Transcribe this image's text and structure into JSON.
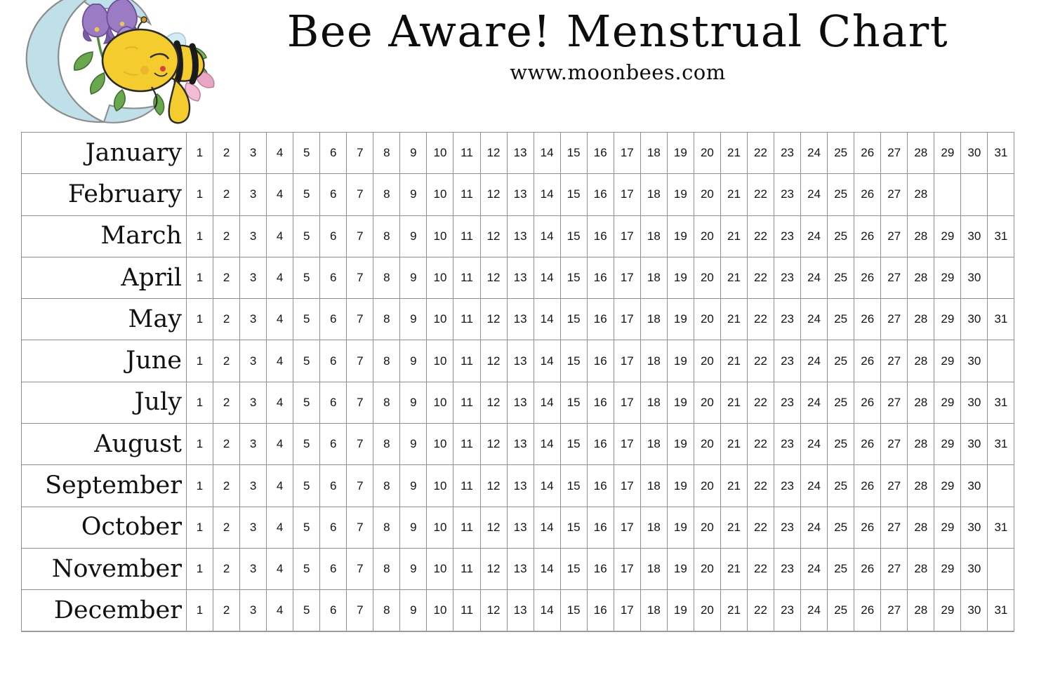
{
  "page": {
    "background_color": "#ffffff"
  },
  "header": {
    "title": "Bee Aware! Menstrual Chart",
    "subtitle": "www.moonbees.com",
    "logo": {
      "name": "moon-bee-logo",
      "description": "sleeping bee on crescent moon with bellflowers",
      "colors": {
        "moon": "#bfe0e8",
        "moon_outline": "#8c8c8c",
        "bee_body": "#f4cc2e",
        "bee_stripe": "#1a1a1a",
        "flower_purple": "#9b7bc4",
        "flower_purple_dark": "#7a5aa8",
        "flower_pink": "#e8a6c4",
        "leaf_green": "#6aa84f",
        "stem_green": "#4e8a3a",
        "wing": "#cfe9f2"
      }
    }
  },
  "table": {
    "columns": {
      "month_header": "",
      "days": [
        1,
        2,
        3,
        4,
        5,
        6,
        7,
        8,
        9,
        10,
        11,
        12,
        13,
        14,
        15,
        16,
        17,
        18,
        19,
        20,
        21,
        22,
        23,
        24,
        25,
        26,
        27,
        28,
        29,
        30,
        31
      ]
    },
    "total_day_columns": 31,
    "grid_color": "#8f8f8f",
    "rows": [
      {
        "month": "January",
        "days_in_month": 31
      },
      {
        "month": "February",
        "days_in_month": 28
      },
      {
        "month": "March",
        "days_in_month": 31
      },
      {
        "month": "April",
        "days_in_month": 30
      },
      {
        "month": "May",
        "days_in_month": 31
      },
      {
        "month": "June",
        "days_in_month": 30
      },
      {
        "month": "July",
        "days_in_month": 31
      },
      {
        "month": "August",
        "days_in_month": 31
      },
      {
        "month": "September",
        "days_in_month": 30
      },
      {
        "month": "October",
        "days_in_month": 31
      },
      {
        "month": "November",
        "days_in_month": 30
      },
      {
        "month": "December",
        "days_in_month": 31
      }
    ]
  },
  "chart_data": {
    "type": "table",
    "title": "Bee Aware! Menstrual Chart",
    "subtitle": "www.moonbees.com",
    "description": "Blank 12-month menstrual tracking grid; one row per month, one cell per day of month, all cells empty for marking.",
    "row_labels": [
      "January",
      "February",
      "March",
      "April",
      "May",
      "June",
      "July",
      "August",
      "September",
      "October",
      "November",
      "December"
    ],
    "column_labels": [
      1,
      2,
      3,
      4,
      5,
      6,
      7,
      8,
      9,
      10,
      11,
      12,
      13,
      14,
      15,
      16,
      17,
      18,
      19,
      20,
      21,
      22,
      23,
      24,
      25,
      26,
      27,
      28,
      29,
      30,
      31
    ],
    "values": [
      [
        1,
        2,
        3,
        4,
        5,
        6,
        7,
        8,
        9,
        10,
        11,
        12,
        13,
        14,
        15,
        16,
        17,
        18,
        19,
        20,
        21,
        22,
        23,
        24,
        25,
        26,
        27,
        28,
        29,
        30,
        31
      ],
      [
        1,
        2,
        3,
        4,
        5,
        6,
        7,
        8,
        9,
        10,
        11,
        12,
        13,
        14,
        15,
        16,
        17,
        18,
        19,
        20,
        21,
        22,
        23,
        24,
        25,
        26,
        27,
        28,
        null,
        null,
        null
      ],
      [
        1,
        2,
        3,
        4,
        5,
        6,
        7,
        8,
        9,
        10,
        11,
        12,
        13,
        14,
        15,
        16,
        17,
        18,
        19,
        20,
        21,
        22,
        23,
        24,
        25,
        26,
        27,
        28,
        29,
        30,
        31
      ],
      [
        1,
        2,
        3,
        4,
        5,
        6,
        7,
        8,
        9,
        10,
        11,
        12,
        13,
        14,
        15,
        16,
        17,
        18,
        19,
        20,
        21,
        22,
        23,
        24,
        25,
        26,
        27,
        28,
        29,
        30,
        null
      ],
      [
        1,
        2,
        3,
        4,
        5,
        6,
        7,
        8,
        9,
        10,
        11,
        12,
        13,
        14,
        15,
        16,
        17,
        18,
        19,
        20,
        21,
        22,
        23,
        24,
        25,
        26,
        27,
        28,
        29,
        30,
        31
      ],
      [
        1,
        2,
        3,
        4,
        5,
        6,
        7,
        8,
        9,
        10,
        11,
        12,
        13,
        14,
        15,
        16,
        17,
        18,
        19,
        20,
        21,
        22,
        23,
        24,
        25,
        26,
        27,
        28,
        29,
        30,
        null
      ],
      [
        1,
        2,
        3,
        4,
        5,
        6,
        7,
        8,
        9,
        10,
        11,
        12,
        13,
        14,
        15,
        16,
        17,
        18,
        19,
        20,
        21,
        22,
        23,
        24,
        25,
        26,
        27,
        28,
        29,
        30,
        31
      ],
      [
        1,
        2,
        3,
        4,
        5,
        6,
        7,
        8,
        9,
        10,
        11,
        12,
        13,
        14,
        15,
        16,
        17,
        18,
        19,
        20,
        21,
        22,
        23,
        24,
        25,
        26,
        27,
        28,
        29,
        30,
        31
      ],
      [
        1,
        2,
        3,
        4,
        5,
        6,
        7,
        8,
        9,
        10,
        11,
        12,
        13,
        14,
        15,
        16,
        17,
        18,
        19,
        20,
        21,
        22,
        23,
        24,
        25,
        26,
        27,
        28,
        29,
        30,
        null
      ],
      [
        1,
        2,
        3,
        4,
        5,
        6,
        7,
        8,
        9,
        10,
        11,
        12,
        13,
        14,
        15,
        16,
        17,
        18,
        19,
        20,
        21,
        22,
        23,
        24,
        25,
        26,
        27,
        28,
        29,
        30,
        31
      ],
      [
        1,
        2,
        3,
        4,
        5,
        6,
        7,
        8,
        9,
        10,
        11,
        12,
        13,
        14,
        15,
        16,
        17,
        18,
        19,
        20,
        21,
        22,
        23,
        24,
        25,
        26,
        27,
        28,
        29,
        30,
        null
      ],
      [
        1,
        2,
        3,
        4,
        5,
        6,
        7,
        8,
        9,
        10,
        11,
        12,
        13,
        14,
        15,
        16,
        17,
        18,
        19,
        20,
        21,
        22,
        23,
        24,
        25,
        26,
        27,
        28,
        29,
        30,
        31
      ]
    ]
  }
}
